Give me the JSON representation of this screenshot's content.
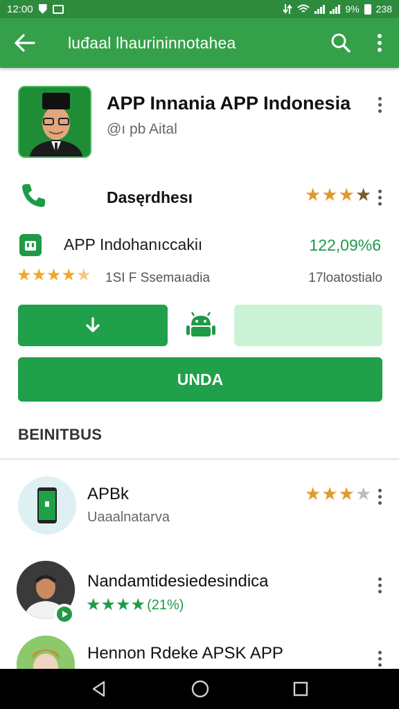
{
  "status_bar": {
    "time": "12:00",
    "battery": "9%",
    "right_text": "238"
  },
  "app_bar": {
    "title": "luđaal lhaurininnotahea",
    "back_icon": "arrow-left-icon",
    "search_icon": "search-icon",
    "menu_icon": "more-vert-icon"
  },
  "app": {
    "title": "APP Innania APP Indonesia",
    "developer": "@ı pb Aital"
  },
  "contact": {
    "title": "Dasęrdhesı",
    "rating": 3.5
  },
  "app_row": {
    "name": "APP Indohanıccakiı",
    "value": "122,09%6"
  },
  "rating_row": {
    "stars": 4.5,
    "text": "1SI F Ssemaıadia",
    "right": "17loatostialo"
  },
  "buttons": {
    "download_icon": "download-icon",
    "android_icon": "android-icon",
    "main_label": "UNDA"
  },
  "section": {
    "title": "BEINITBUS"
  },
  "list": [
    {
      "title": "APBk",
      "subtitle": "Uaaalnatarva",
      "rating": 3.5
    },
    {
      "title": "Nandamtidesiedesindica",
      "stars_text": "(21%)",
      "rating": 4.5
    },
    {
      "title": "Hennon Rdeke APSK APP"
    }
  ],
  "colors": {
    "primary": "#35a04a",
    "status": "#2e8b3e",
    "accent_green": "#20a04a",
    "star": "#f4a623"
  }
}
